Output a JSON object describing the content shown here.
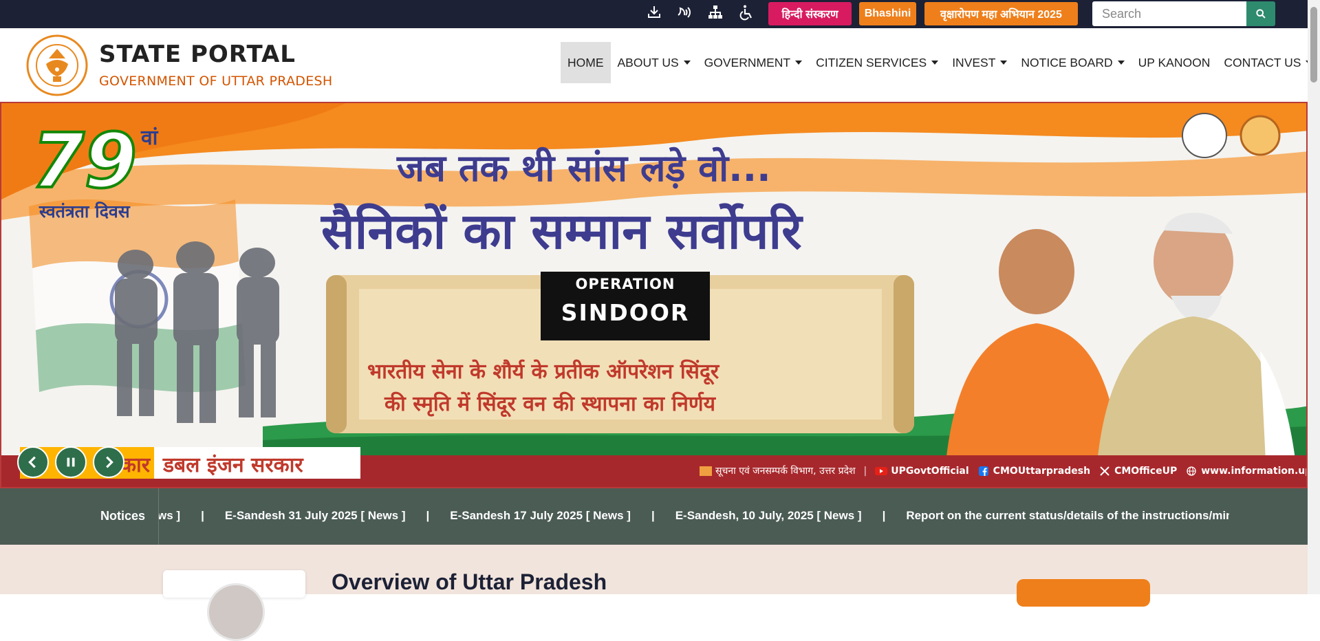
{
  "topbar": {
    "icons": [
      "download-icon",
      "audio-icon",
      "sitemap-icon",
      "accessibility-icon"
    ],
    "hindi_label": "हिन्दी संस्करण",
    "bhashini_label": "Bhashini",
    "campaign_label": "वृक्षारोपण महा अभियान 2025",
    "search_placeholder": "Search",
    "colors": {
      "bar": "#1c2136",
      "hindi": "#d81b60",
      "orange": "#ef7f1a",
      "search_btn": "#2e8b6e"
    }
  },
  "header": {
    "title": "STATE PORTAL",
    "subtitle": "GOVERNMENT OF UTTAR PRADESH"
  },
  "nav": {
    "items": [
      {
        "label": "HOME",
        "dropdown": false,
        "active": true
      },
      {
        "label": "ABOUT US",
        "dropdown": true
      },
      {
        "label": "GOVERNMENT",
        "dropdown": true
      },
      {
        "label": "CITIZEN SERVICES",
        "dropdown": true
      },
      {
        "label": "INVEST",
        "dropdown": true
      },
      {
        "label": "NOTICE BOARD",
        "dropdown": true
      },
      {
        "label": "UP KANOON",
        "dropdown": false
      },
      {
        "label": "CONTACT US",
        "dropdown": true
      }
    ]
  },
  "banner": {
    "num": "79",
    "num_suffix": "वां",
    "independence_day": "स्वतंत्रता दिवस",
    "headline_1": "जब तक थी सांस लड़े वो...",
    "headline_2": "सैनिकों का सम्मान सर्वोपरि",
    "op_line1": "OPERATION",
    "op_line2": "SINDOOR",
    "scroll_text_1": "भारतीय सेना के शौर्य के प्रतीक ऑपरेशन सिंदूर",
    "scroll_text_2": "की स्मृति में सिंदूर वन की स्थापना का निर्णय",
    "double_engine_left": "कार",
    "double_engine": "डबल इंजन सरकार",
    "credits": {
      "dept": "सूचना एवं जनसम्पर्क विभाग, उत्तर प्रदेश",
      "youtube": "UPGovtOfficial",
      "facebook": "CMOUttarpradesh",
      "x": "CMOfficeUP",
      "web": "www.information.up.gov.in"
    }
  },
  "notices": {
    "label": "Notices",
    "items": [
      "ws ]",
      "E-Sandesh 31 July 2025 [ News ]",
      "E-Sandesh 17 July 2025 [ News ]",
      "E-Sandesh, 10 July, 2025 [ News ]",
      "Report on the current status/details of the instructions/minut"
    ],
    "separator": "|"
  },
  "overview": {
    "title": "Overview of Uttar Pradesh"
  }
}
